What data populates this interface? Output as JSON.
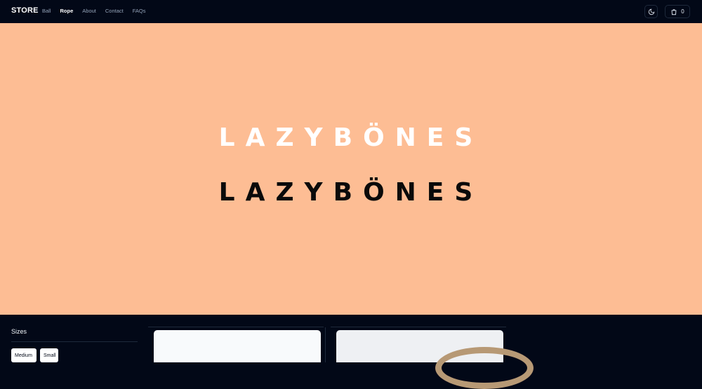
{
  "header": {
    "brand": "STORE",
    "nav": [
      {
        "label": "Ball",
        "active": false
      },
      {
        "label": "Rope",
        "active": true
      },
      {
        "label": "About",
        "active": false
      },
      {
        "label": "Contact",
        "active": false
      },
      {
        "label": "FAQs",
        "active": false
      }
    ],
    "theme_icon": "moon-icon",
    "cart_icon": "shopping-bag-icon",
    "cart_count": "0"
  },
  "hero": {
    "logo_white": "LAZYBÖNES",
    "logo_black": "LAZYBÖNES",
    "background": "#fdbd94"
  },
  "filters": {
    "title": "Sizes",
    "options": [
      "Medium",
      "Small"
    ]
  }
}
